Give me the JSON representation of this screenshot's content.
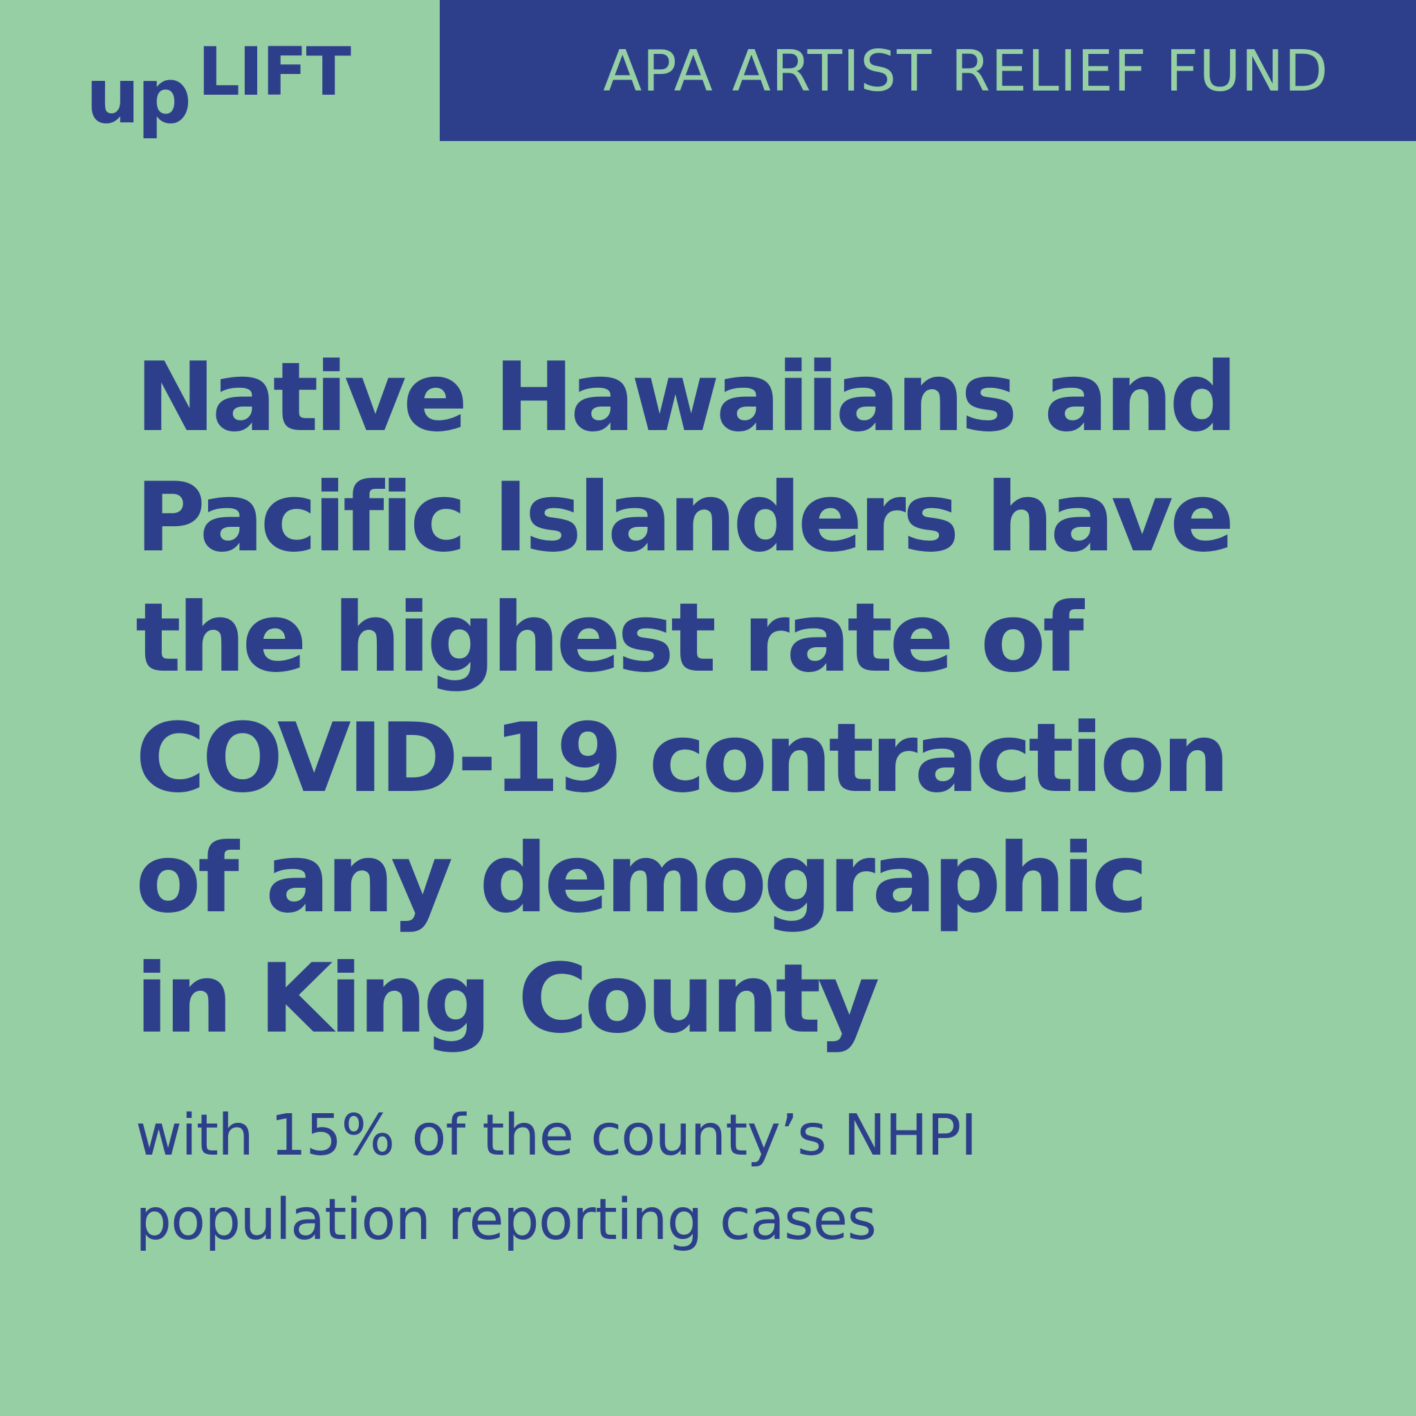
{
  "logo": {
    "up": "up",
    "lift": "LIFT"
  },
  "banner": {
    "title": "APA ARTIST RELIEF FUND"
  },
  "headline": {
    "lines": [
      "Native Hawaiians and",
      "Pacific Islanders have",
      "the highest rate of",
      "COVID-19 contraction",
      "of any demographic",
      "in King County"
    ]
  },
  "subtext": {
    "lines": [
      "with 15% of the county’s NHPI",
      "population reporting cases"
    ]
  },
  "colors": {
    "background": "#96cfa4",
    "brand_blue": "#2d3f8a"
  }
}
